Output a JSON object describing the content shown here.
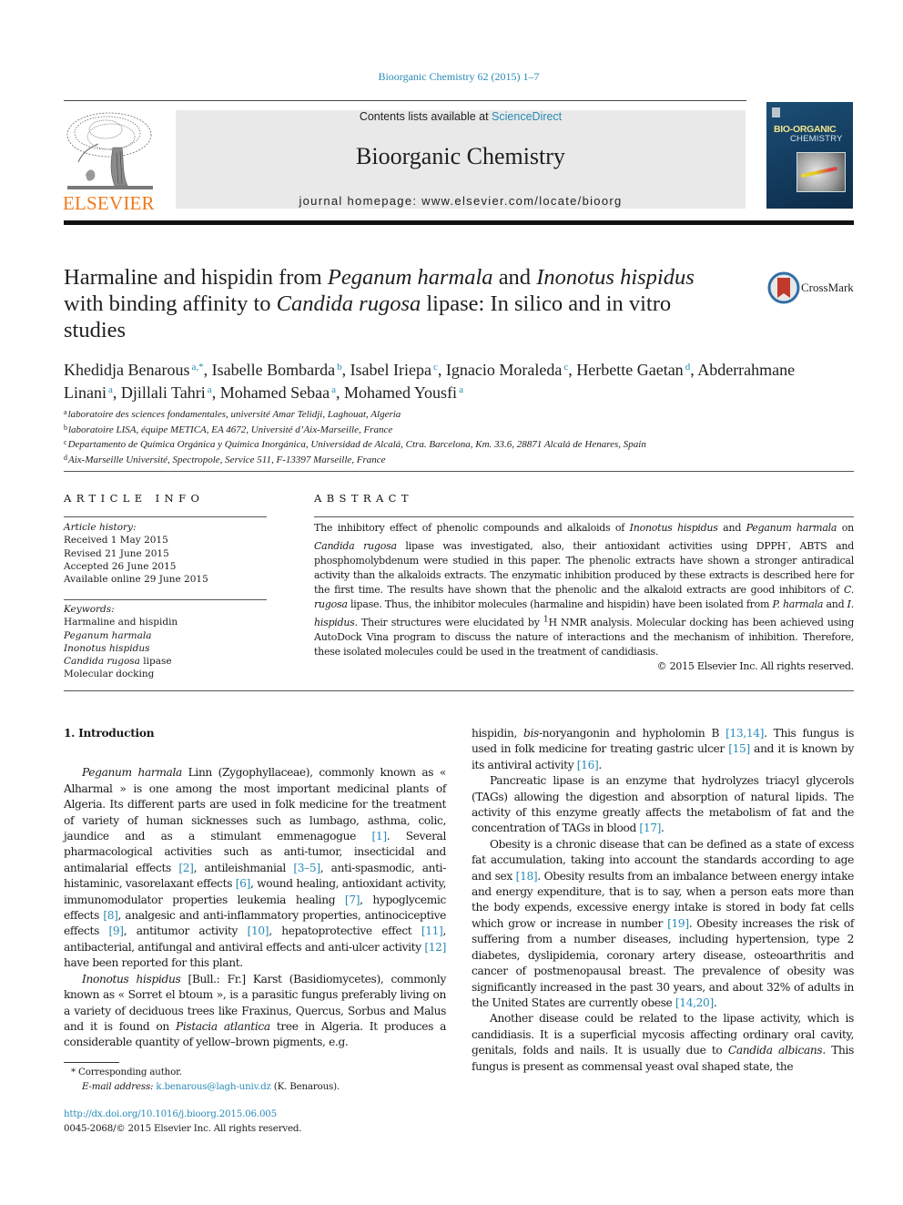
{
  "header": {
    "journal_reference": "Bioorganic Chemistry 62 (2015) 1–7",
    "contents_prefix": "Contents lists available at ",
    "contents_link": "ScienceDirect",
    "journal_name": "Bioorganic Chemistry",
    "homepage": "journal homepage: www.elsevier.com/locate/bioorg",
    "publisher_logo_text": "ELSEVIER",
    "cover": {
      "title_line1": "BIO-ORGANIC",
      "title_line2": "CHEMISTRY"
    },
    "colors": {
      "link": "#2a8bb5",
      "publisher_orange": "#f07a1a",
      "masthead_bg": "#e9e9e9"
    }
  },
  "article": {
    "title_parts": [
      {
        "text": "Harmaline and hispidin from ",
        "italic": false
      },
      {
        "text": "Peganum harmala",
        "italic": true
      },
      {
        "text": " and ",
        "italic": false
      },
      {
        "text": "Inonotus hispidus",
        "italic": true
      },
      {
        "text": " with binding affinity to ",
        "italic": false
      },
      {
        "text": "Candida rugosa",
        "italic": true
      },
      {
        "text": " lipase: In silico and in vitro studies",
        "italic": false
      }
    ],
    "crossmark_label": "CrossMark",
    "authors": [
      {
        "name": "Khedidja Benarous",
        "aff": "a,*"
      },
      {
        "name": "Isabelle Bombarda",
        "aff": "b"
      },
      {
        "name": "Isabel Iriepa",
        "aff": "c"
      },
      {
        "name": "Ignacio Moraleda",
        "aff": "c"
      },
      {
        "name": "Herbette Gaetan",
        "aff": "d"
      },
      {
        "name": "Abderrahmane Linani",
        "aff": "a"
      },
      {
        "name": "Djillali Tahri",
        "aff": "a"
      },
      {
        "name": "Mohamed Sebaa",
        "aff": "a"
      },
      {
        "name": "Mohamed Yousfi",
        "aff": "a"
      }
    ],
    "affiliations": [
      {
        "key": "a",
        "text": "laboratoire des sciences fondamentales, université Amar Telidji, Laghouat, Algeria"
      },
      {
        "key": "b",
        "text": "laboratoire LISA, équipe METICA, EA 4672, Université d’Aix-Marseille, France"
      },
      {
        "key": "c",
        "text": "Departamento de Química Orgánica y Química Inorgánica, Universidad de Alcalá, Ctra. Barcelona, Km. 33.6, 28871 Alcalá de Henares, Spain"
      },
      {
        "key": "d",
        "text": "Aix-Marseille Université, Spectropole, Service 511, F-13397 Marseille, France"
      }
    ]
  },
  "article_info": {
    "heading": "ARTICLE INFO",
    "history_label": "Article history:",
    "history": [
      "Received 1 May 2015",
      "Revised 21 June 2015",
      "Accepted 26 June 2015",
      "Available online 29 June 2015"
    ],
    "keywords_label": "Keywords:",
    "keywords": [
      {
        "parts": [
          {
            "text": "Harmaline and hispidin",
            "italic": false
          }
        ]
      },
      {
        "parts": [
          {
            "text": "Peganum harmala",
            "italic": true
          }
        ]
      },
      {
        "parts": [
          {
            "text": "Inonotus hispidus",
            "italic": true
          }
        ]
      },
      {
        "parts": [
          {
            "text": "Candida rugosa",
            "italic": true
          },
          {
            "text": " lipase",
            "italic": false
          }
        ]
      },
      {
        "parts": [
          {
            "text": "Molecular docking",
            "italic": false
          }
        ]
      }
    ]
  },
  "abstract": {
    "heading": "ABSTRACT",
    "parts": [
      {
        "text": "The inhibitory effect of phenolic compounds and alkaloids of ",
        "style": "n"
      },
      {
        "text": "Inonotus hispidus",
        "style": "i"
      },
      {
        "text": " and ",
        "style": "n"
      },
      {
        "text": "Peganum harmala",
        "style": "i"
      },
      {
        "text": " on ",
        "style": "n"
      },
      {
        "text": "Candida rugosa",
        "style": "i"
      },
      {
        "text": " lipase was investigated, also, their antioxidant activities using DPPH",
        "style": "n"
      },
      {
        "text": "·",
        "style": "sup"
      },
      {
        "text": ", ABTS and phosphomolybdenum were studied in this paper. The phenolic extracts have shown a stronger antiradical activity than the alkaloids extracts. The enzymatic inhibition produced by these extracts is described here for the first time. The results have shown that the phenolic and the alkaloid extracts are good inhibitors of ",
        "style": "n"
      },
      {
        "text": "C. rugosa",
        "style": "i"
      },
      {
        "text": " lipase. Thus, the inhibitor molecules (harmaline and hispidin) have been isolated from ",
        "style": "n"
      },
      {
        "text": "P. harmala",
        "style": "i"
      },
      {
        "text": " and ",
        "style": "n"
      },
      {
        "text": "I. hispidus",
        "style": "i"
      },
      {
        "text": ". Their structures were elucidated by ",
        "style": "n"
      },
      {
        "text": "1",
        "style": "sup"
      },
      {
        "text": "H NMR analysis. Molecular docking has been achieved using AutoDock Vina program to discuss the nature of interactions and the mechanism of inhibition. Therefore, these isolated molecules could be used in the treatment of candidiasis.",
        "style": "n"
      }
    ],
    "copyright": "© 2015 Elsevier Inc. All rights reserved."
  },
  "body": {
    "section_heading": "1. Introduction",
    "left_paragraphs": [
      [
        {
          "t": "Peganum harmala",
          "s": "i"
        },
        {
          "t": " Linn (Zygophyllaceae), commonly known as « Alharmal » is one among the most important medicinal plants of Algeria. Its different parts are used in folk medicine for the treatment of variety of human sicknesses such as lumbago, asthma, colic, jaundice and as a stimulant emmenagogue ",
          "s": "n"
        },
        {
          "t": "[1]",
          "s": "c"
        },
        {
          "t": ". Several pharmacological activities such as anti-tumor, insecticidal and antimalarial effects ",
          "s": "n"
        },
        {
          "t": "[2]",
          "s": "c"
        },
        {
          "t": ", antileishmanial ",
          "s": "n"
        },
        {
          "t": "[3–5]",
          "s": "c"
        },
        {
          "t": ", anti-spasmodic, anti-histaminic, vasorelaxant effects ",
          "s": "n"
        },
        {
          "t": "[6]",
          "s": "c"
        },
        {
          "t": ", wound healing, antioxidant activity, immunomodulator properties leukemia healing ",
          "s": "n"
        },
        {
          "t": "[7]",
          "s": "c"
        },
        {
          "t": ", hypoglycemic effects ",
          "s": "n"
        },
        {
          "t": "[8]",
          "s": "c"
        },
        {
          "t": ", analgesic and anti-inflammatory properties, antinociceptive effects ",
          "s": "n"
        },
        {
          "t": "[9]",
          "s": "c"
        },
        {
          "t": ", antitumor activity ",
          "s": "n"
        },
        {
          "t": "[10]",
          "s": "c"
        },
        {
          "t": ", hepatoprotective effect ",
          "s": "n"
        },
        {
          "t": "[11]",
          "s": "c"
        },
        {
          "t": ", antibacterial, antifungal and antiviral effects and anti-ulcer activity ",
          "s": "n"
        },
        {
          "t": "[12]",
          "s": "c"
        },
        {
          "t": " have been reported for this plant.",
          "s": "n"
        }
      ],
      [
        {
          "t": "Inonotus hispidus",
          "s": "i"
        },
        {
          "t": " [Bull.: Fr.] Karst (Basidiomycetes), commonly known as « Sorret el btoum », is a parasitic fungus preferably living on a variety of deciduous trees like Fraxinus, Quercus, Sorbus and Malus and it is found on ",
          "s": "n"
        },
        {
          "t": "Pistacia atlantica",
          "s": "i"
        },
        {
          "t": " tree in Algeria. It produces a considerable quantity of yellow–brown pigments, e.g.",
          "s": "n"
        }
      ]
    ],
    "right_paragraphs": [
      [
        {
          "t": "hispidin, ",
          "s": "n"
        },
        {
          "t": "bis",
          "s": "i"
        },
        {
          "t": "-noryangonin and hypholomin B ",
          "s": "n"
        },
        {
          "t": "[13,14]",
          "s": "c"
        },
        {
          "t": ". This fungus is used in folk medicine for treating gastric ulcer ",
          "s": "n"
        },
        {
          "t": "[15]",
          "s": "c"
        },
        {
          "t": " and it is known by its antiviral activity ",
          "s": "n"
        },
        {
          "t": "[16]",
          "s": "c"
        },
        {
          "t": ".",
          "s": "n"
        }
      ],
      [
        {
          "t": "Pancreatic lipase is an enzyme that hydrolyzes triacyl glycerols (TAGs) allowing the digestion and absorption of natural lipids. The activity of this enzyme greatly affects the metabolism of fat and the concentration of TAGs in blood ",
          "s": "n"
        },
        {
          "t": "[17]",
          "s": "c"
        },
        {
          "t": ".",
          "s": "n"
        }
      ],
      [
        {
          "t": "Obesity is a chronic disease that can be defined as a state of excess fat accumulation, taking into account the standards according to age and sex ",
          "s": "n"
        },
        {
          "t": "[18]",
          "s": "c"
        },
        {
          "t": ". Obesity results from an imbalance between energy intake and energy expenditure, that is to say, when a person eats more than the body expends, excessive energy intake is stored in body fat cells which grow or increase in number ",
          "s": "n"
        },
        {
          "t": "[19]",
          "s": "c"
        },
        {
          "t": ". Obesity increases the risk of suffering from a number diseases, including hypertension, type 2 diabetes, dyslipidemia, coronary artery disease, osteoarthritis and cancer of postmenopausal breast. The prevalence of obesity was significantly increased in the past 30 years, and about 32% of adults in the United States are currently obese ",
          "s": "n"
        },
        {
          "t": "[14,20]",
          "s": "c"
        },
        {
          "t": ".",
          "s": "n"
        }
      ],
      [
        {
          "t": "Another disease could be related to the lipase activity, which is candidiasis. It is a superficial mycosis affecting ordinary oral cavity, genitals, folds and nails. It is usually due to ",
          "s": "n"
        },
        {
          "t": "Candida albicans",
          "s": "i"
        },
        {
          "t": ". This fungus is present as commensal yeast oval shaped state, the",
          "s": "n"
        }
      ]
    ]
  },
  "footer": {
    "corresponding_marker": "*",
    "corresponding_label": "Corresponding author.",
    "email_label": "E-mail address:",
    "email": "k.benarous@lagh-univ.dz",
    "email_owner": "(K. Benarous).",
    "doi": "http://dx.doi.org/10.1016/j.bioorg.2015.06.005",
    "issn_copyright": "0045-2068/© 2015 Elsevier Inc. All rights reserved."
  }
}
